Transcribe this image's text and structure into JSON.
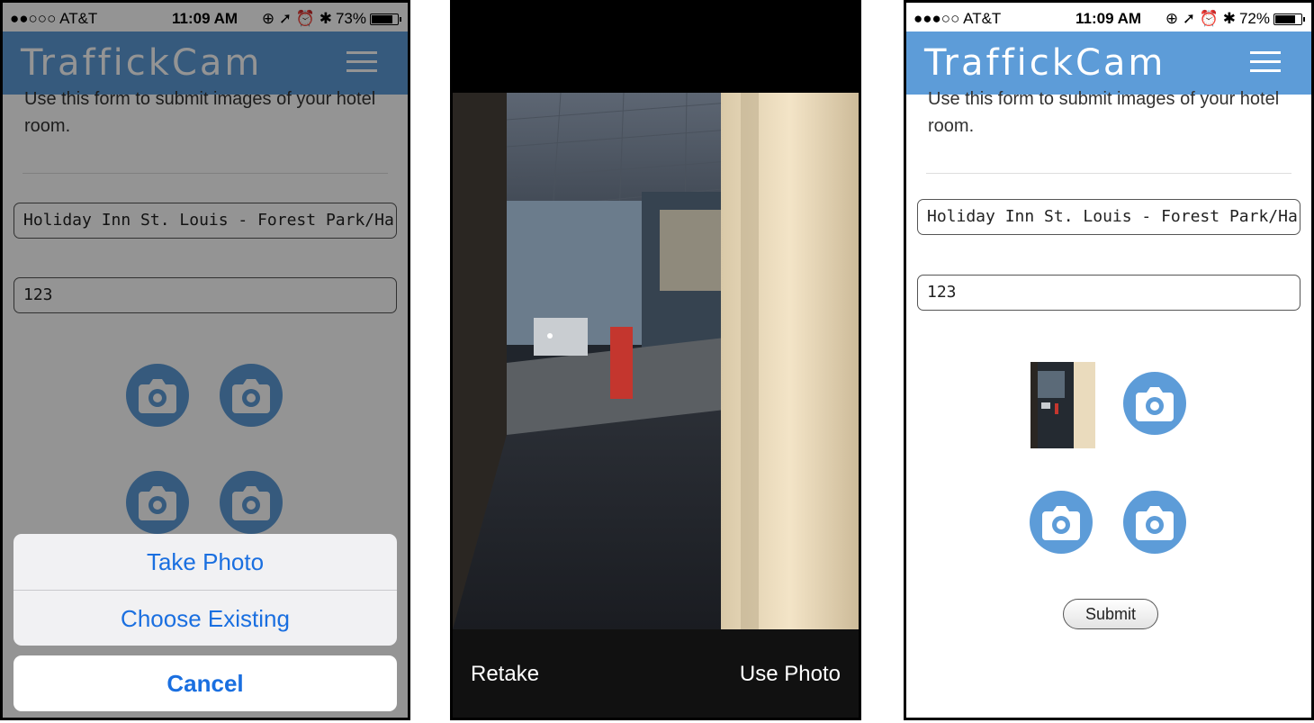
{
  "screens": [
    {
      "status": {
        "carrier": "●●○○○ AT&T",
        "time": "11:09 AM",
        "battery": "73%",
        "battery_level": 0.73
      },
      "app_title": "TraffickCam",
      "intro_text": "Use this form to submit images of your hotel room.",
      "hotel_field": "Holiday Inn St. Louis - Forest Park/Ha",
      "room_field": "123",
      "action_sheet": {
        "take_photo": "Take Photo",
        "choose_existing": "Choose Existing",
        "cancel": "Cancel"
      }
    },
    {
      "retake": "Retake",
      "use_photo": "Use Photo"
    },
    {
      "status": {
        "carrier": "●●●○○ AT&T",
        "time": "11:09 AM",
        "battery": "72%",
        "battery_level": 0.72
      },
      "app_title": "TraffickCam",
      "intro_text": "Use this form to submit images of your hotel room.",
      "hotel_field": "Holiday Inn St. Louis - Forest Park/Ha",
      "room_field": "123",
      "submit": "Submit"
    }
  ],
  "icons": {
    "camera": "camera-icon",
    "menu": "hamburger-menu-icon"
  },
  "colors": {
    "brand_blue": "#5d9cd8",
    "ios_blue": "#1a6fe0"
  }
}
